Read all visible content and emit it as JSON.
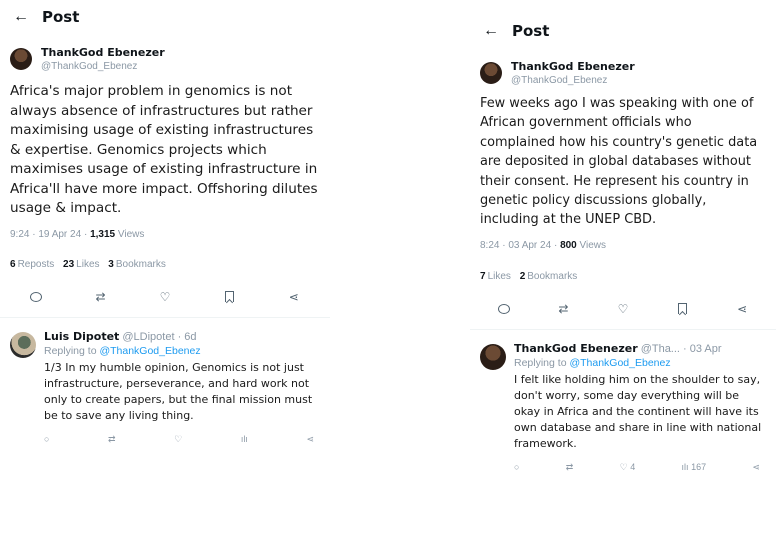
{
  "left": {
    "header_title": "Post",
    "author_name": "ThankGod Ebenezer",
    "author_handle": "@ThankGod_Ebenez",
    "tweet_text": "Africa's major problem in genomics is not always absence of infrastructures but rather  maximising usage of existing infrastructures & expertise. Genomics projects which maximises usage of existing infrastructure in Africa'll have more impact. Offshoring dilutes usage & impact.",
    "time_date": "9:24 · 19 Apr 24 ·",
    "views_count": "1,315",
    "views_label": "Views",
    "reposts_count": "6",
    "reposts_label": "Reposts",
    "likes_count": "23",
    "likes_label": "Likes",
    "bookmarks_count": "3",
    "bookmarks_label": "Bookmarks",
    "reply": {
      "name": "Luis Dipotet",
      "handle_time": "@LDipotet · 6d",
      "replying_prefix": "Replying to",
      "replying_handle": "@ThankGod_Ebenez",
      "text": "1/3 In my humble opinion, Genomics is not just infrastructure, perseverance, and hard work not only to create papers, but the final mission must be to save any living thing."
    }
  },
  "right": {
    "header_title": "Post",
    "author_name": "ThankGod Ebenezer",
    "author_handle": "@ThankGod_Ebenez",
    "tweet_text": "Few weeks ago I was speaking with one of African government officials who complained how his country's genetic data are deposited in global databases without their consent. He represent his country in genetic policy discussions globally, including at the UNEP CBD.",
    "time_date": "8:24 · 03 Apr 24 ·",
    "views_count": "800",
    "views_label": "Views",
    "likes_count": "7",
    "likes_label": "Likes",
    "bookmarks_count": "2",
    "bookmarks_label": "Bookmarks",
    "reply": {
      "name": "ThankGod Ebenezer",
      "handle_time": "@Tha... · 03 Apr",
      "replying_prefix": "Replying to",
      "replying_handle": "@ThankGod_Ebenez",
      "text": "I felt like holding him on the shoulder to say, don't worry, some day everything will be okay in Africa and the continent will have its own database and share in line with national framework.",
      "like_count": "4",
      "views_count": "167"
    }
  },
  "icons": {
    "back": "arrow-left-icon",
    "reply": "reply-icon",
    "repost": "repost-icon",
    "like": "heart-icon",
    "bookmark": "bookmark-icon",
    "share": "share-icon"
  }
}
